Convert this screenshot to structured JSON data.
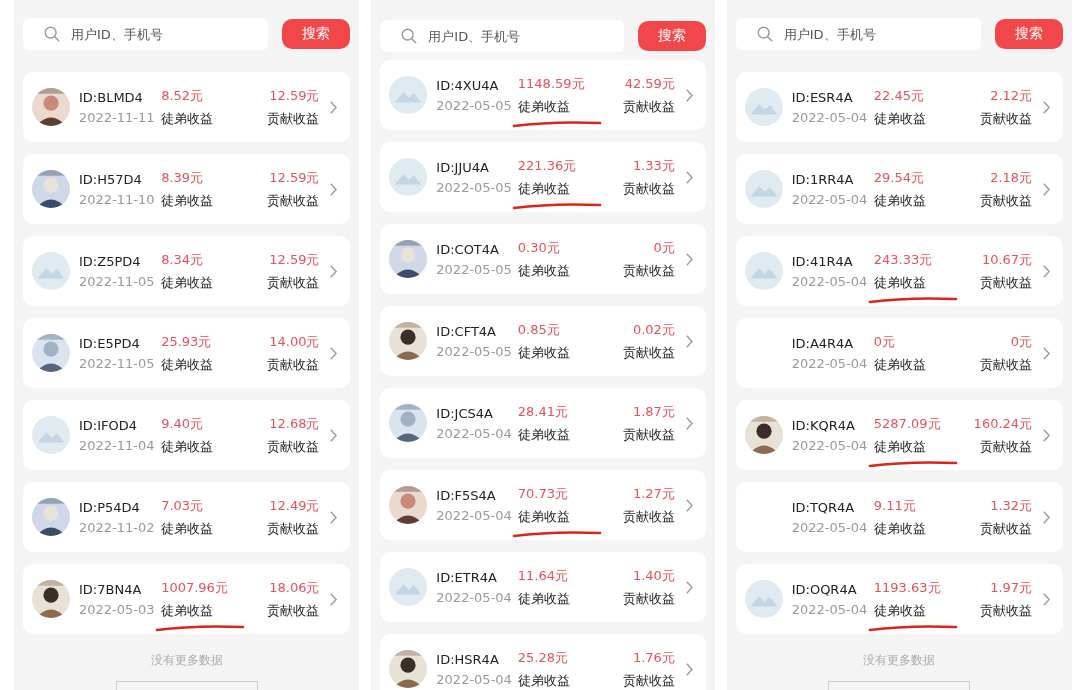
{
  "panels": [
    {
      "search": {
        "placeholder": "用户ID、手机号",
        "button": "搜索"
      },
      "rows": [
        {
          "id": "ID:BLMD4",
          "date": "2022-11-11",
          "income": "8.52元",
          "income_label": "徒弟收益",
          "contribution": "12.59元",
          "contribution_label": "贡献收益",
          "marked": false
        },
        {
          "id": "ID:H57D4",
          "date": "2022-11-10",
          "income": "8.39元",
          "income_label": "徒弟收益",
          "contribution": "12.59元",
          "contribution_label": "贡献收益",
          "marked": false
        },
        {
          "id": "ID:Z5PD4",
          "date": "2022-11-05",
          "income": "8.34元",
          "income_label": "徒弟收益",
          "contribution": "12.59元",
          "contribution_label": "贡献收益",
          "avatar": {
            "kind": "placeholder"
          },
          "marked": false
        },
        {
          "id": "ID:E5PD4",
          "date": "2022-11-05",
          "income": "25.93元",
          "income_label": "徒弟收益",
          "contribution": "14.00元",
          "contribution_label": "贡献收益",
          "marked": false
        },
        {
          "id": "ID:IFOD4",
          "date": "2022-11-04",
          "income": "9.40元",
          "income_label": "徒弟收益",
          "contribution": "12.68元",
          "contribution_label": "贡献收益",
          "avatar": {
            "kind": "placeholder"
          },
          "marked": false
        },
        {
          "id": "ID:P54D4",
          "date": "2022-11-02",
          "income": "7.03元",
          "income_label": "徒弟收益",
          "contribution": "12.49元",
          "contribution_label": "贡献收益",
          "marked": false
        },
        {
          "id": "ID:7BN4A",
          "date": "2022-05-03",
          "income": "1007.96元",
          "income_label": "徒弟收益",
          "contribution": "18.06元",
          "contribution_label": "贡献收益",
          "marked": true
        }
      ],
      "footer": "没有更多数据"
    },
    {
      "search": {
        "placeholder": "用户ID、手机号",
        "button": "搜索"
      },
      "rows": [
        {
          "id": "ID:4XU4A",
          "date": "2022-05-05",
          "income": "1148.59元",
          "income_label": "徒弟收益",
          "contribution": "42.59元",
          "contribution_label": "贡献收益",
          "avatar": {
            "kind": "placeholder"
          },
          "marked": true
        },
        {
          "id": "ID:JJU4A",
          "date": "2022-05-05",
          "income": "221.36元",
          "income_label": "徒弟收益",
          "contribution": "1.33元",
          "contribution_label": "贡献收益",
          "avatar": {
            "kind": "placeholder"
          },
          "marked": true
        },
        {
          "id": "ID:COT4A",
          "date": "2022-05-05",
          "income": "0.30元",
          "income_label": "徒弟收益",
          "contribution": "0元",
          "contribution_label": "贡献收益",
          "marked": false
        },
        {
          "id": "ID:CFT4A",
          "date": "2022-05-05",
          "income": "0.85元",
          "income_label": "徒弟收益",
          "contribution": "0.02元",
          "contribution_label": "贡献收益",
          "marked": false
        },
        {
          "id": "ID:JCS4A",
          "date": "2022-05-04",
          "income": "28.41元",
          "income_label": "徒弟收益",
          "contribution": "1.87元",
          "contribution_label": "贡献收益",
          "marked": false
        },
        {
          "id": "ID:F5S4A",
          "date": "2022-05-04",
          "income": "70.73元",
          "income_label": "徒弟收益",
          "contribution": "1.27元",
          "contribution_label": "贡献收益",
          "marked": true
        },
        {
          "id": "ID:ETR4A",
          "date": "2022-05-04",
          "income": "11.64元",
          "income_label": "徒弟收益",
          "contribution": "1.40元",
          "contribution_label": "贡献收益",
          "avatar": {
            "kind": "placeholder"
          },
          "marked": false
        },
        {
          "id": "ID:HSR4A",
          "date": "2022-05-04",
          "income": "25.28元",
          "income_label": "徒弟收益",
          "contribution": "1.76元",
          "contribution_label": "贡献收益",
          "marked": false
        }
      ]
    },
    {
      "search": {
        "placeholder": "用户ID、手机号",
        "button": "搜索"
      },
      "rows": [
        {
          "id": "ID:ESR4A",
          "date": "2022-05-04",
          "income": "22.45元",
          "income_label": "徒弟收益",
          "contribution": "2.12元",
          "contribution_label": "贡献收益",
          "avatar": {
            "kind": "placeholder"
          },
          "marked": false
        },
        {
          "id": "ID:1RR4A",
          "date": "2022-05-04",
          "income": "29.54元",
          "income_label": "徒弟收益",
          "contribution": "2.18元",
          "contribution_label": "贡献收益",
          "avatar": {
            "kind": "placeholder"
          },
          "marked": false
        },
        {
          "id": "ID:41R4A",
          "date": "2022-05-04",
          "income": "243.33元",
          "income_label": "徒弟收益",
          "contribution": "10.67元",
          "contribution_label": "贡献收益",
          "avatar": {
            "kind": "placeholder"
          },
          "marked": true
        },
        {
          "id": "ID:A4R4A",
          "date": "2022-05-04",
          "income": "0元",
          "income_label": "徒弟收益",
          "contribution": "0元",
          "contribution_label": "贡献收益",
          "avatar": {
            "kind": "none"
          },
          "marked": false
        },
        {
          "id": "ID:KQR4A",
          "date": "2022-05-04",
          "income": "5287.09元",
          "income_label": "徒弟收益",
          "contribution": "160.24元",
          "contribution_label": "贡献收益",
          "marked": true
        },
        {
          "id": "ID:TQR4A",
          "date": "2022-05-04",
          "income": "9.11元",
          "income_label": "徒弟收益",
          "contribution": "1.32元",
          "contribution_label": "贡献收益",
          "avatar": {
            "kind": "none"
          },
          "marked": false
        },
        {
          "id": "ID:OQR4A",
          "date": "2022-05-04",
          "income": "1193.63元",
          "income_label": "徒弟收益",
          "contribution": "1.97元",
          "contribution_label": "贡献收益",
          "avatar": {
            "kind": "placeholder"
          },
          "marked": true
        }
      ],
      "footer": "没有更多数据"
    }
  ]
}
